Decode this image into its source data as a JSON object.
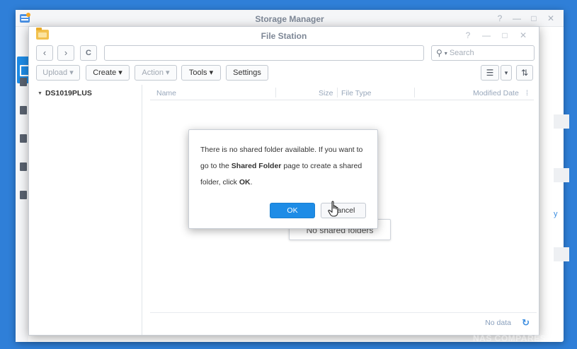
{
  "storage_manager": {
    "title": "Storage Manager",
    "right_link": "y"
  },
  "file_station": {
    "title": "File Station",
    "window_controls": {
      "help": "?",
      "minimize": "—",
      "maximize": "□",
      "close": "✕"
    },
    "navigation": {
      "back": "‹",
      "forward": "›",
      "refresh": "C",
      "path_value": "",
      "search_placeholder": "Search"
    },
    "toolbar": {
      "upload": "Upload ▾",
      "create": "Create ▾",
      "action": "Action ▾",
      "tools": "Tools ▾",
      "settings": "Settings",
      "view_list": "☰",
      "view_dropdown": "▾",
      "sort": "⇅"
    },
    "tree": {
      "root": "DS1019PLUS"
    },
    "columns": [
      "Name",
      "Size",
      "File Type",
      "Modified Date"
    ],
    "empty_message": "No shared folders",
    "footer": {
      "status": "No data"
    }
  },
  "dialog": {
    "message_pre": "There is no shared folder available. If you want to go to the ",
    "message_bold": "Shared Folder",
    "message_mid": " page to create a shared folder, click ",
    "message_ok_bold": "OK",
    "message_end": ".",
    "ok_label": "OK",
    "cancel_label": "Cancel"
  },
  "watermark": "NAS COMPARES",
  "colors": {
    "desktop": "#2f7fd8",
    "accent": "#1e8ce6"
  }
}
